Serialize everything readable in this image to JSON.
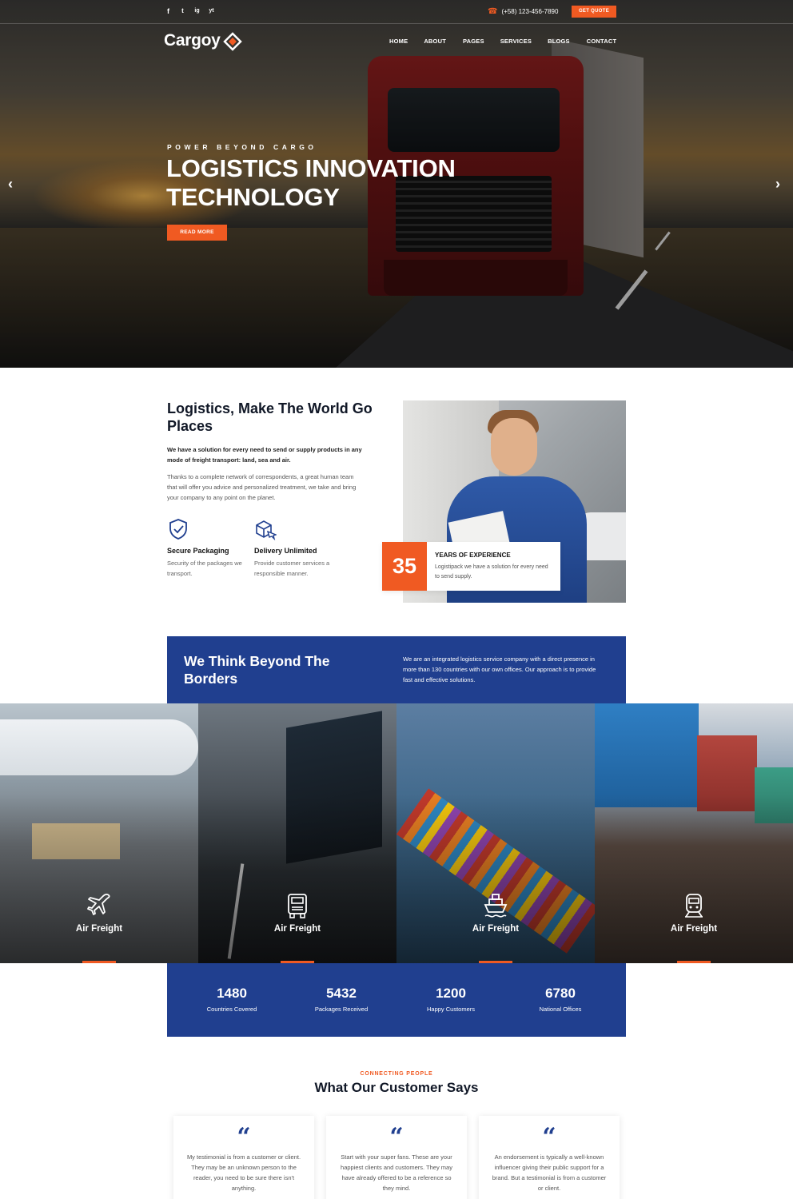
{
  "topbar": {
    "social": [
      "f",
      "t",
      "ig",
      "yt"
    ],
    "phone": "(+58) 123-456-7890",
    "quote_label": "GET QUOTE"
  },
  "header": {
    "logo_text": "Cargoy",
    "nav": [
      "HOME",
      "ABOUT",
      "PAGES",
      "SERVICES",
      "BLOGS",
      "CONTACT"
    ]
  },
  "hero": {
    "kicker": "POWER BEYOND CARGO",
    "title": "LOGISTICS INNOVATION TECHNOLOGY",
    "button": "READ MORE",
    "prev_arrow": "‹",
    "next_arrow": "›"
  },
  "about": {
    "title": "Logistics, Make The World Go Places",
    "lead": "We have a solution for every need to send or supply products in any mode of freight transport: land, sea and air.",
    "body": "Thanks to a complete network of correspondents, a great human team that will offer you advice and personalized treatment, we take and bring your company to any point on the planet.",
    "features": [
      {
        "title": "Secure Packaging",
        "desc": "Security of the packages we transport.",
        "icon": "shield-check-icon"
      },
      {
        "title": "Delivery Unlimited",
        "desc": "Provide customer services a responsible manner.",
        "icon": "box-plane-icon"
      }
    ],
    "experience": {
      "number": "35",
      "title": "YEARS OF EXPERIENCE",
      "desc": "Logistipack we have a solution for every need to send supply."
    }
  },
  "banner": {
    "title": "We Think Beyond The Borders",
    "text": "We are an integrated logistics service company with a direct presence in more than 130 countries with our own offices. Our approach is to provide fast and effective solutions."
  },
  "services": [
    {
      "label": "Air Freight",
      "icon": "airplane-icon"
    },
    {
      "label": "Air Freight",
      "icon": "truck-icon"
    },
    {
      "label": "Air Freight",
      "icon": "ship-icon"
    },
    {
      "label": "Air Freight",
      "icon": "train-icon"
    }
  ],
  "stats": [
    {
      "value": "1480",
      "label": "Countries Covered"
    },
    {
      "value": "5432",
      "label": "Packages Received"
    },
    {
      "value": "1200",
      "label": "Happy Customers"
    },
    {
      "value": "6780",
      "label": "National Offices"
    }
  ],
  "testimonials": {
    "kicker": "CONNECTING PEOPLE",
    "title": "What Our Customer Says",
    "quote_mark": "“",
    "items": [
      "My testimonial is from a customer or client. They may be an unknown person to the reader, you need to be sure there isn't anything.",
      "Start with your super fans. These are your happiest clients and customers. They may have already offered to be a reference so they mind.",
      "An endorsement is typically a well-known influencer giving their public support for a brand. But a testimonial is from a customer or client."
    ]
  },
  "colors": {
    "accent": "#f05a22",
    "brand_blue": "#203f8f",
    "dark_text": "#111827"
  }
}
